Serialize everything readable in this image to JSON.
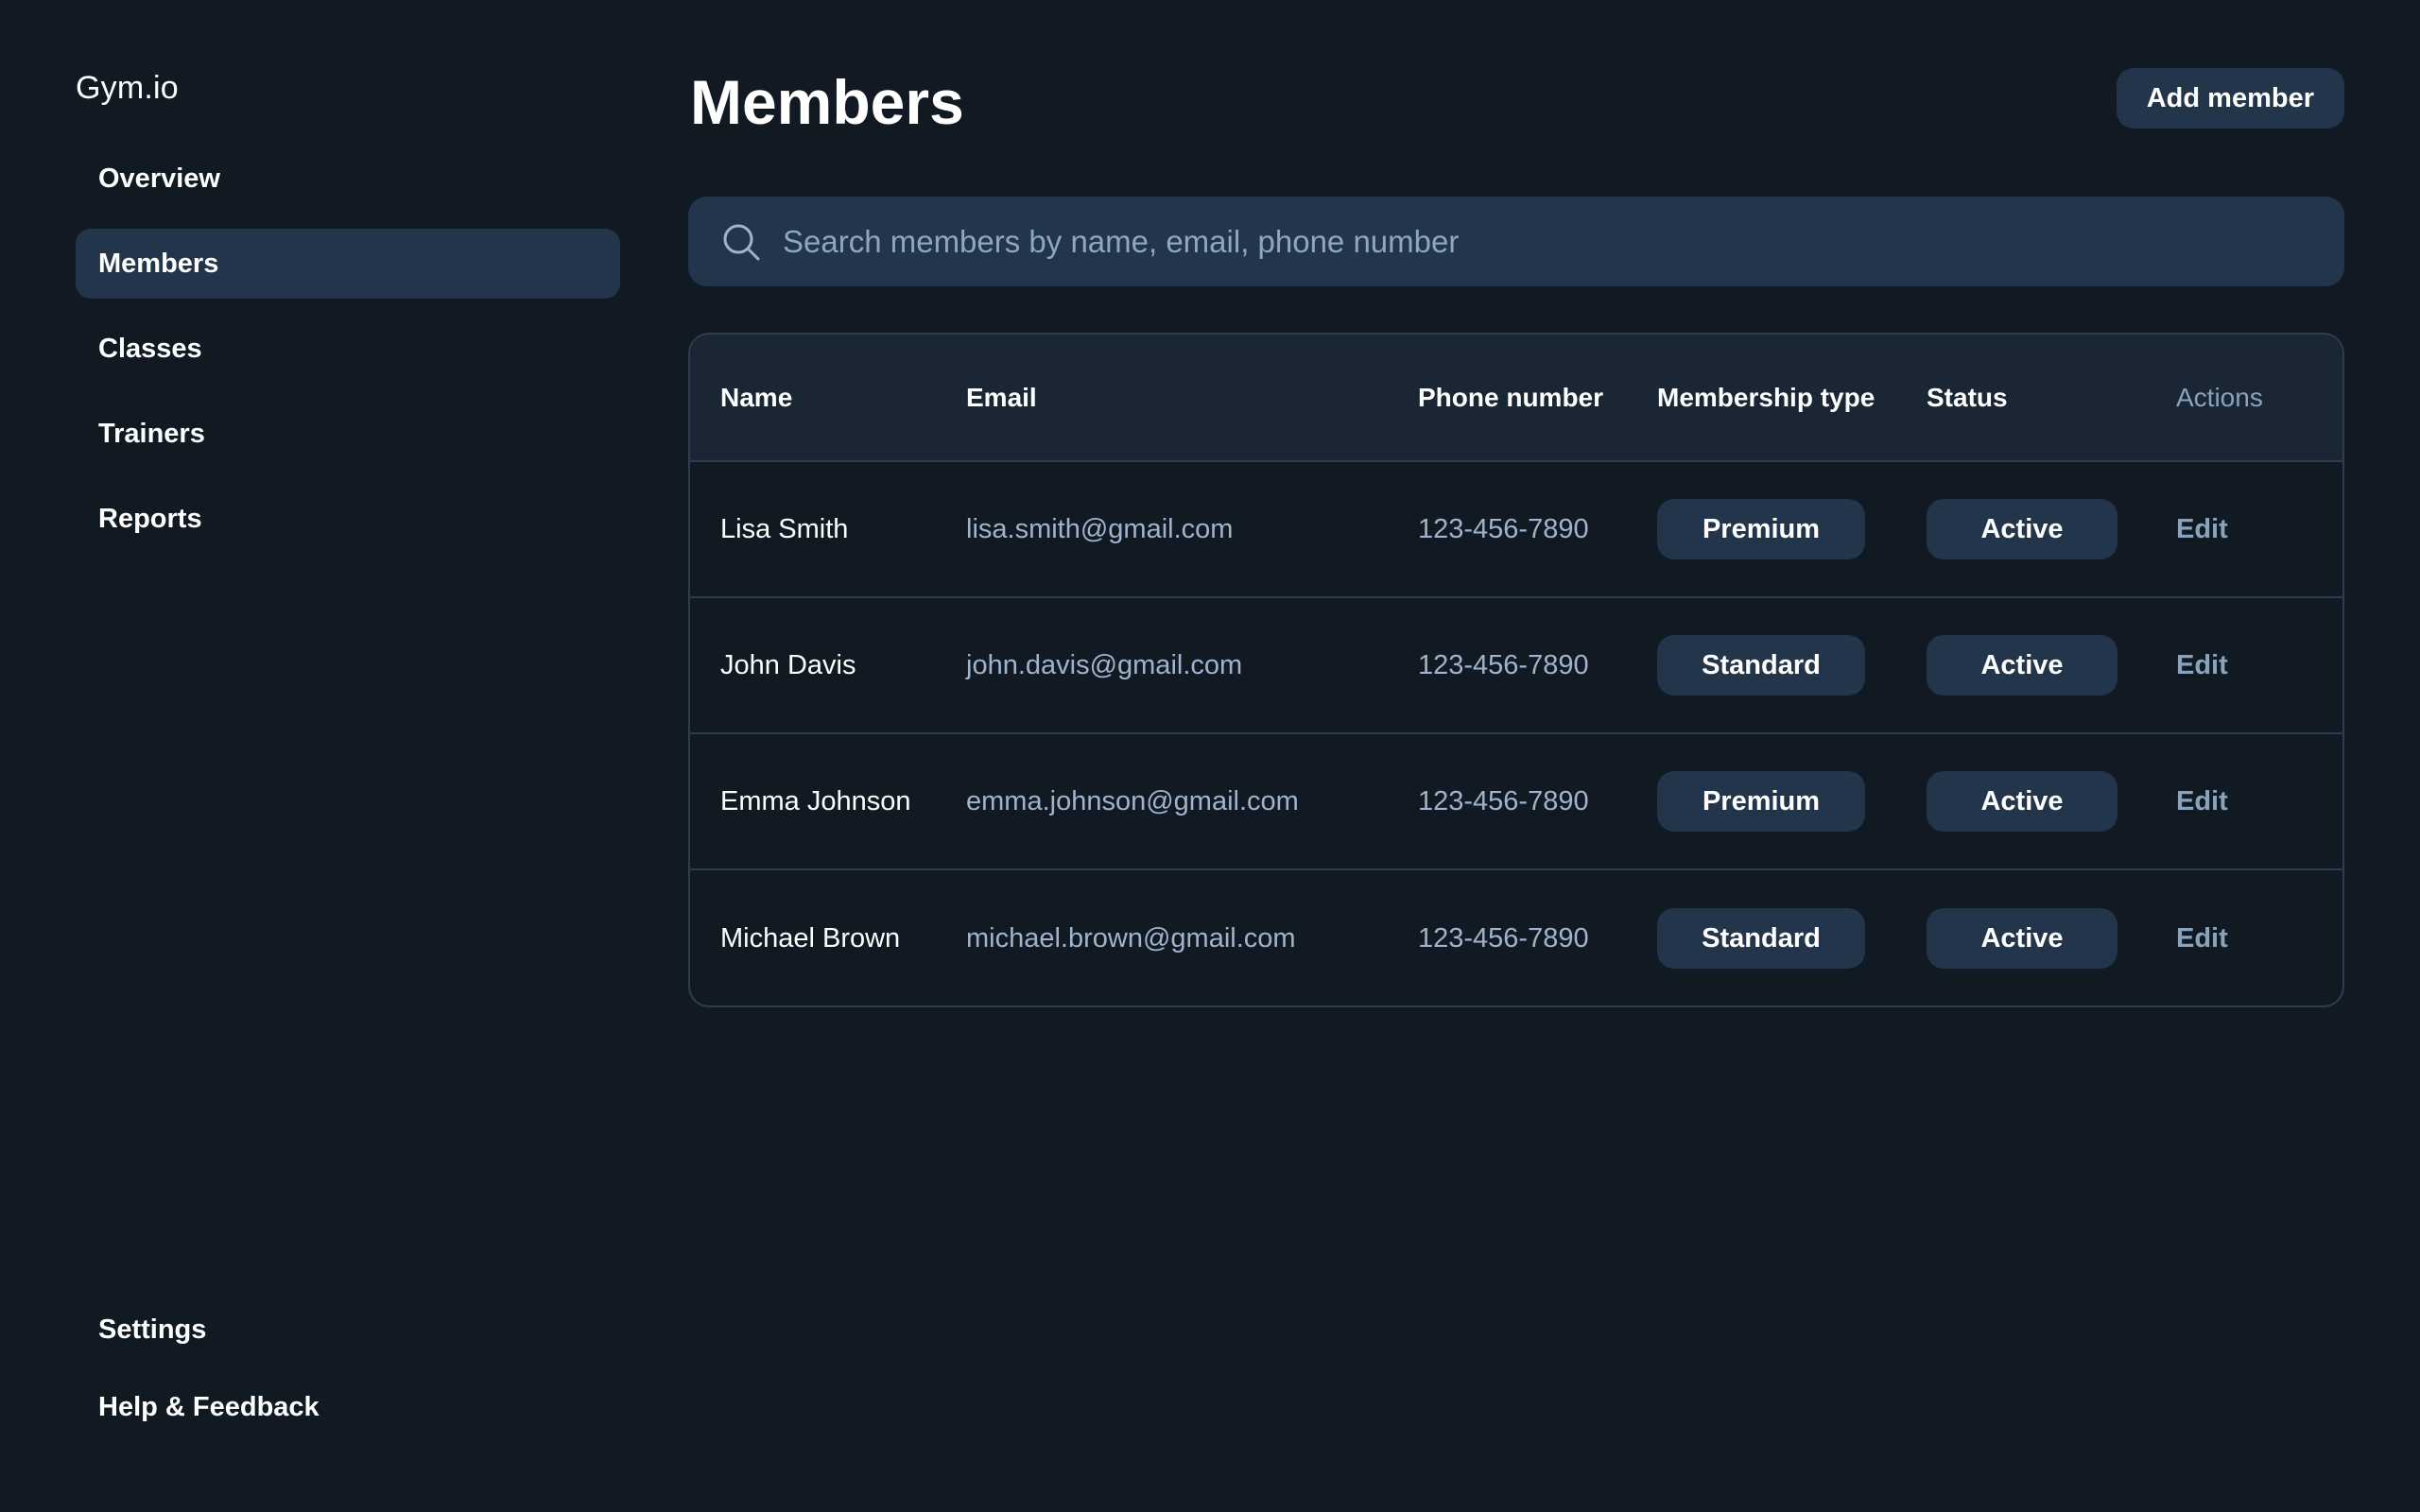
{
  "app": {
    "brand": "Gym.io"
  },
  "sidebar": {
    "items": [
      {
        "label": "Overview",
        "active": false
      },
      {
        "label": "Members",
        "active": true
      },
      {
        "label": "Classes",
        "active": false
      },
      {
        "label": "Trainers",
        "active": false
      },
      {
        "label": "Reports",
        "active": false
      }
    ],
    "bottom_items": [
      {
        "label": "Settings"
      },
      {
        "label": "Help & Feedback"
      }
    ]
  },
  "header": {
    "title": "Members",
    "add_button_label": "Add member"
  },
  "search": {
    "placeholder": "Search members by name, email, phone number",
    "value": "",
    "icon": "search-icon"
  },
  "table": {
    "columns": [
      "Name",
      "Email",
      "Phone number",
      "Membership type",
      "Status",
      "Actions"
    ],
    "rows": [
      {
        "name": "Lisa Smith",
        "email": "lisa.smith@gmail.com",
        "phone": "123-456-7890",
        "membership_type": "Premium",
        "status": "Active",
        "action": "Edit"
      },
      {
        "name": "John Davis",
        "email": "john.davis@gmail.com",
        "phone": "123-456-7890",
        "membership_type": "Standard",
        "status": "Active",
        "action": "Edit"
      },
      {
        "name": "Emma Johnson",
        "email": "emma.johnson@gmail.com",
        "phone": "123-456-7890",
        "membership_type": "Premium",
        "status": "Active",
        "action": "Edit"
      },
      {
        "name": "Michael Brown",
        "email": "michael.brown@gmail.com",
        "phone": "123-456-7890",
        "membership_type": "Standard",
        "status": "Active",
        "action": "Edit"
      }
    ]
  },
  "colors": {
    "background": "#111a23",
    "surface": "#23354a",
    "table_header": "#1b2634",
    "border": "#2c3e52",
    "muted_text": "#9fb4cc",
    "link": "#8aa3bd"
  }
}
